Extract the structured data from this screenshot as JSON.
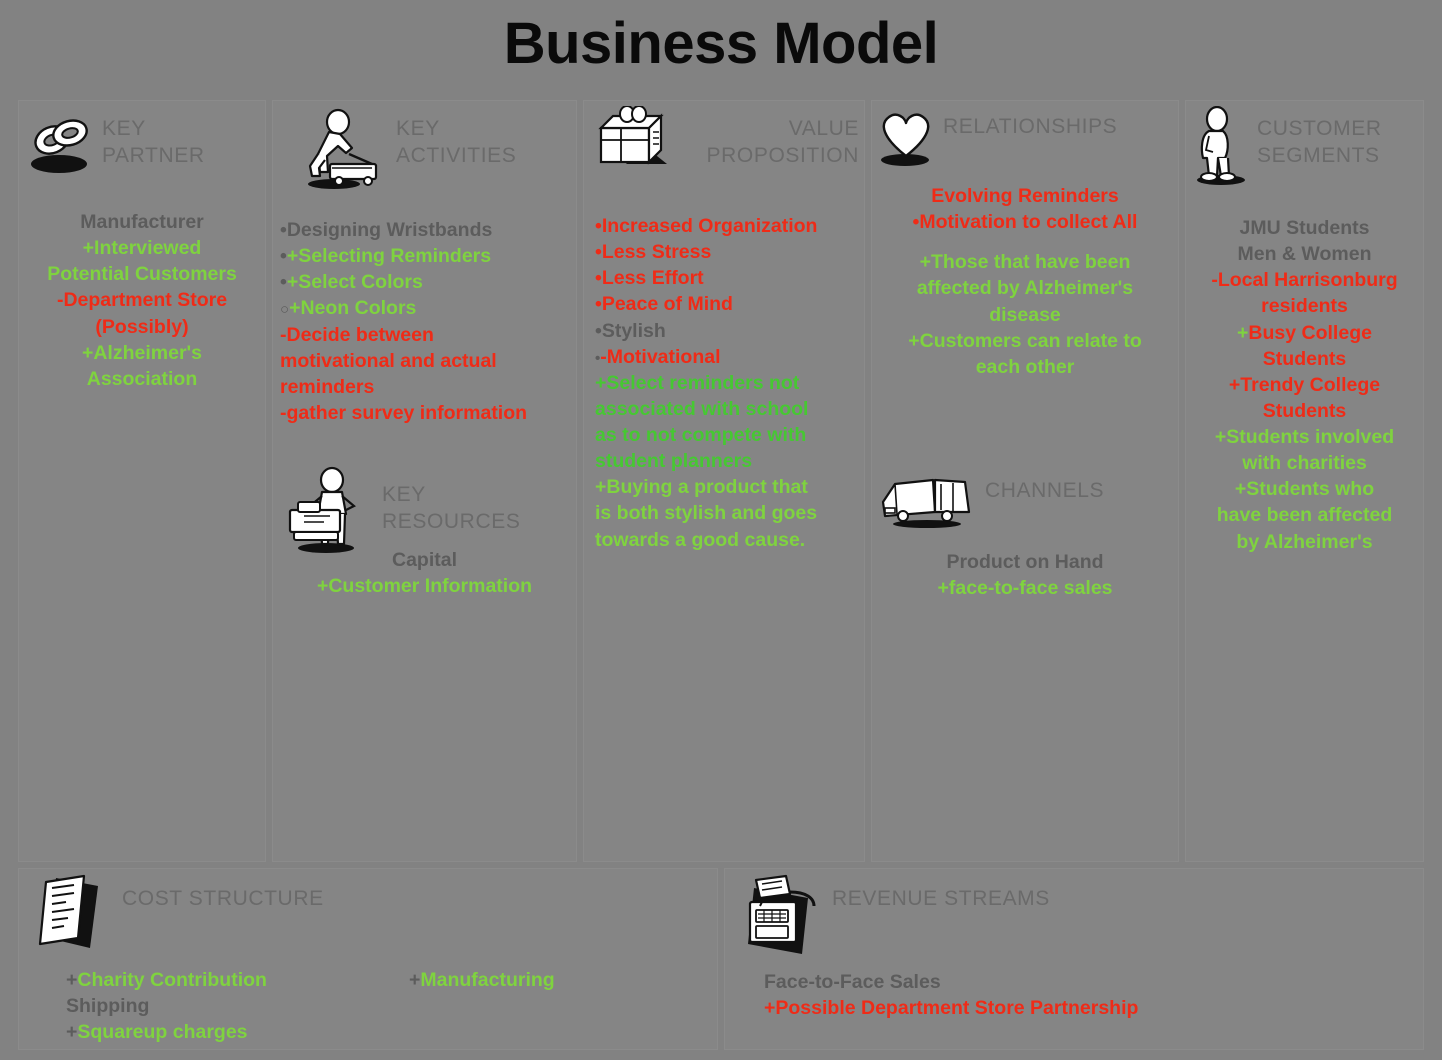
{
  "page": {
    "title": "Business Model",
    "background_color": "#828282",
    "panel_color": "#858585",
    "colors": {
      "gray_text": "#5c5c5c",
      "header_gray": "#6a6a6a",
      "red": "#ef2b17",
      "green": "#7fd33f",
      "green_bright": "#46c832",
      "title_black": "#0a0a0a"
    }
  },
  "blocks": {
    "key_partner": {
      "header": "KEY\nPARTNER",
      "header_line1": "KEY",
      "header_line2": "PARTNER",
      "icon": "rings-icon",
      "lines": [
        {
          "text": "Manufacturer",
          "color": "gray"
        },
        {
          "prefix": "+",
          "prefix_color": "green",
          "text": "Interviewed",
          "color": "green"
        },
        {
          "text": "Potential Customers",
          "color": "green"
        },
        {
          "prefix": "-",
          "prefix_color": "red",
          "text": "Department Store",
          "color": "red"
        },
        {
          "text": "(Possibly)",
          "color": "red"
        },
        {
          "prefix": "+",
          "prefix_color": "green",
          "text": "Alzheimer's",
          "color": "green"
        },
        {
          "text": "Association",
          "color": "green"
        }
      ]
    },
    "key_activities": {
      "header_line1": "KEY",
      "header_line2": "ACTIVITIES",
      "icon": "worker-mowing-icon",
      "lines": [
        {
          "bullet": "•",
          "bullet_color": "gray",
          "text": "Designing Wristbands",
          "color": "gray"
        },
        {
          "bullet": "•",
          "bullet_color": "gray",
          "prefix": "+",
          "prefix_color": "green",
          "text": "Selecting Reminders",
          "color": "green"
        },
        {
          "bullet": "•",
          "bullet_color": "gray",
          "prefix": "+",
          "prefix_color": "green",
          "text": "Select Colors",
          "color": "green"
        },
        {
          "bullet": "○",
          "bullet_color": "gray",
          "prefix": "+",
          "prefix_color": "green",
          "text": "Neon Colors",
          "color": "green"
        },
        {
          "prefix": "-",
          "prefix_color": "red",
          "text": "Decide between",
          "color": "red"
        },
        {
          "text": "motivational and actual",
          "color": "red"
        },
        {
          "text": "reminders",
          "color": "red"
        },
        {
          "prefix": "-",
          "prefix_color": "red",
          "text": "gather survey information",
          "color": "red"
        }
      ]
    },
    "key_resources": {
      "header_line1": "KEY",
      "header_line2": "RESOURCES",
      "icon": "worker-machine-icon",
      "lines": [
        {
          "text": "Capital",
          "color": "gray"
        },
        {
          "prefix": "+",
          "prefix_color": "green",
          "text": "Customer Information",
          "color": "green"
        }
      ]
    },
    "value_proposition": {
      "header_line1": "VALUE",
      "header_line2": "PROPOSITION",
      "icon": "gift-box-icon",
      "lines": [
        {
          "bullet": "•",
          "bullet_color": "red",
          "text": "Increased Organization",
          "color": "red"
        },
        {
          "bullet": "•",
          "bullet_color": "red",
          "text": "Less Stress",
          "color": "red"
        },
        {
          "bullet": "•",
          "bullet_color": "red",
          "text": "Less Effort",
          "color": "red"
        },
        {
          "bullet": "•",
          "bullet_color": "red",
          "text": "Peace of Mind",
          "color": "red"
        },
        {
          "bullet": "•",
          "bullet_color": "gray",
          "text": "Stylish",
          "color": "gray"
        },
        {
          "bullet": "•",
          "bullet_color": "gray",
          "prefix": "-",
          "prefix_color": "red",
          "text": "Motivational",
          "color": "red"
        },
        {
          "prefix": "+",
          "prefix_color": "green_bright",
          "text": "Select reminders not",
          "color": "green_bright"
        },
        {
          "text": "associated with school",
          "color": "green_bright"
        },
        {
          "text": "as to not compete with",
          "color": "green_bright"
        },
        {
          "text": "student planners",
          "color": "green_bright"
        },
        {
          "prefix": "+",
          "prefix_color": "green",
          "text": "Buying a product that",
          "color": "green"
        },
        {
          "text": "is both stylish and goes",
          "color": "green"
        },
        {
          "text": "towards a good cause.",
          "color": "green"
        }
      ]
    },
    "relationships": {
      "header_line1": "RELATIONSHIPS",
      "icon": "heart-icon",
      "lines": [
        {
          "text": "Evolving Reminders",
          "color": "red"
        },
        {
          "bullet": "•",
          "bullet_color": "red",
          "text": "Motivation to collect All",
          "color": "red"
        },
        {
          "spacer": true
        },
        {
          "prefix": "+",
          "prefix_color": "green",
          "text": "Those that have been",
          "color": "green"
        },
        {
          "text": "affected by Alzheimer's",
          "color": "green"
        },
        {
          "text": "disease",
          "color": "green"
        },
        {
          "prefix": "+",
          "prefix_color": "green",
          "text": "Customers can relate to",
          "color": "green"
        },
        {
          "text": "each other",
          "color": "green"
        }
      ]
    },
    "channels": {
      "header_line1": "CHANNELS",
      "icon": "truck-icon",
      "lines": [
        {
          "text": "Product on Hand",
          "color": "gray"
        },
        {
          "prefix": "+",
          "prefix_color": "green",
          "text": "face-to-face sales",
          "color": "green"
        }
      ]
    },
    "customer_segments": {
      "header_line1": "CUSTOMER",
      "header_line2": "SEGMENTS",
      "icon": "person-standing-icon",
      "lines": [
        {
          "text": "JMU Students",
          "color": "gray"
        },
        {
          "text": "Men & Women",
          "color": "gray"
        },
        {
          "prefix": "-",
          "prefix_color": "red",
          "text": "Local Harrisonburg",
          "color": "red"
        },
        {
          "text": "residents",
          "color": "red"
        },
        {
          "prefix": "+",
          "prefix_color": "green",
          "text": "Busy College",
          "color": "red"
        },
        {
          "text": "Students",
          "color": "red"
        },
        {
          "prefix": "+",
          "prefix_color": "red",
          "text": "Trendy College",
          "color": "red"
        },
        {
          "text": "Students",
          "color": "red"
        },
        {
          "prefix": "+",
          "prefix_color": "green",
          "text": "Students involved",
          "color": "green"
        },
        {
          "text": "with charities",
          "color": "green"
        },
        {
          "prefix": "+",
          "prefix_color": "green",
          "text": "Students who",
          "color": "green"
        },
        {
          "text": "have been affected",
          "color": "green"
        },
        {
          "text": "by Alzheimer's",
          "color": "green"
        }
      ]
    },
    "cost_structure": {
      "header_line1": "COST STRUCTURE",
      "icon": "invoice-icon",
      "column_left": [
        {
          "prefix": "+",
          "prefix_color": "gray",
          "text": "Charity Contribution",
          "color": "green"
        },
        {
          "text": "Shipping",
          "color": "gray"
        },
        {
          "prefix": "+",
          "prefix_color": "gray",
          "text": "Squareup charges",
          "color": "green"
        }
      ],
      "column_right": [
        {
          "prefix": "+",
          "prefix_color": "gray",
          "text": "Manufacturing",
          "color": "green"
        }
      ]
    },
    "revenue_streams": {
      "header_line1": "REVENUE STREAMS",
      "icon": "cash-register-icon",
      "lines": [
        {
          "text": "Face-to-Face Sales",
          "color": "gray"
        },
        {
          "prefix": "+",
          "prefix_color": "red",
          "text": "Possible Department Store Partnership",
          "color": "red"
        }
      ]
    }
  }
}
